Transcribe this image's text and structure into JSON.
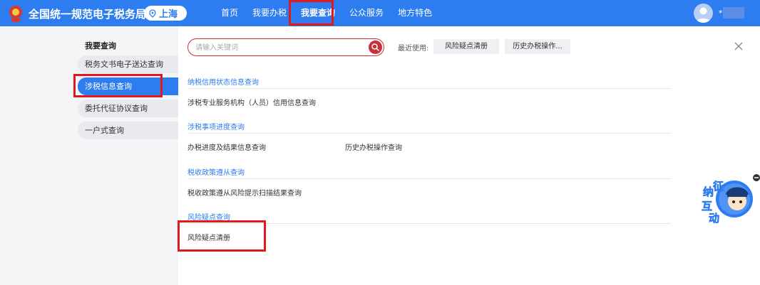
{
  "header": {
    "brand": "全国统一规范电子税务局",
    "region": "上海",
    "nav": [
      "首页",
      "我要办税",
      "我要查询",
      "公众服务",
      "地方特色"
    ],
    "active_nav": "我要查询",
    "user_mask": "*"
  },
  "sidebar": {
    "title": "我要查询",
    "items": [
      "税务文书电子送达查询",
      "涉税信息查询",
      "委托代征协议查询",
      "一户式查询"
    ]
  },
  "main": {
    "search_placeholder": "请输入关键词",
    "recent_label": "最近使用:",
    "recent_tags": [
      "风险疑点清册",
      "历史办税操作..."
    ],
    "sections": [
      {
        "title": "纳税信用状态信息查询",
        "links": [
          "涉税专业服务机构（人员）信用信息查询"
        ]
      },
      {
        "title": "涉税事项进度查询",
        "links": [
          "办税进度及结果信息查询",
          "历史办税操作查询"
        ]
      },
      {
        "title": "税收政策遵从查询",
        "links": [
          "税收政策遵从风险提示扫描结果查询"
        ]
      },
      {
        "title": "风险疑点查询",
        "links": [
          "风险疑点清册"
        ]
      }
    ]
  },
  "float": {
    "chars": [
      "征",
      "纳",
      "互",
      "动"
    ]
  },
  "colors": {
    "primary": "#2d7cf0",
    "highlight": "#e0191f",
    "search_border": "#c9303a"
  }
}
